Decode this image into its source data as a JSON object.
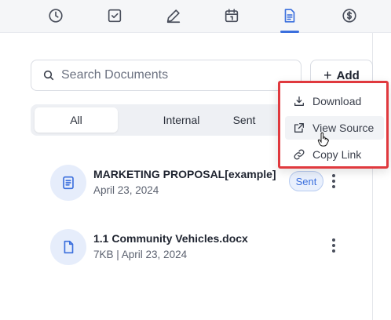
{
  "toolbar": {
    "icons": [
      "clock-icon",
      "checkbox-icon",
      "pen-icon",
      "calendar-icon",
      "document-icon",
      "dollar-icon"
    ],
    "active": "document-icon",
    "accent": "#3b6fdd"
  },
  "search": {
    "placeholder": "Search Documents"
  },
  "add_button": {
    "label": "Add"
  },
  "tabs": [
    {
      "label": "All",
      "active": true
    },
    {
      "label": "Internal",
      "active": false
    },
    {
      "label": "Sent",
      "active": false
    }
  ],
  "documents": [
    {
      "title": "MARKETING PROPOSAL[example]",
      "subtitle": "April 23, 2024",
      "badge": "Sent",
      "icon": "document-icon"
    },
    {
      "title": "1.1 Community Vehicles.docx",
      "subtitle": "7KB | April 23, 2024",
      "icon": "file-icon"
    }
  ],
  "context_menu": {
    "highlight_color": "#e0393e",
    "items": [
      {
        "label": "Download",
        "icon": "download-icon"
      },
      {
        "label": "View Source",
        "icon": "external-link-icon",
        "hovered": true
      },
      {
        "label": "Copy Link",
        "icon": "link-icon"
      }
    ]
  }
}
